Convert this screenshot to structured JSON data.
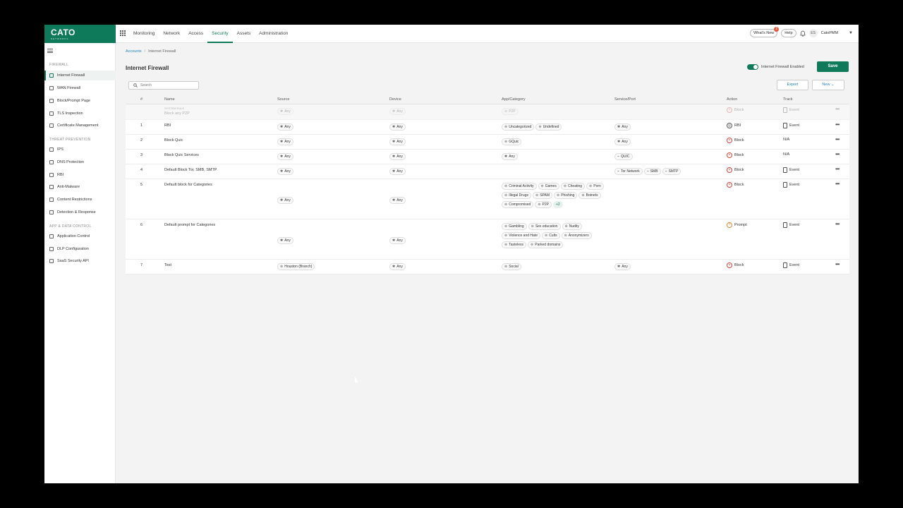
{
  "logo": {
    "brand": "CATO",
    "sub": "NETWORKS"
  },
  "nav": [
    "Monitoring",
    "Network",
    "Access",
    "Security",
    "Assets",
    "Administration"
  ],
  "active_nav": "Security",
  "top_right": {
    "whats_new": "What's New",
    "whats_new_count": "2",
    "help": "Help",
    "avatar": "ES",
    "account": "CatoPMM"
  },
  "sidebar": {
    "sections": [
      {
        "title": "FIREWALL",
        "items": [
          "Internet Firewall",
          "WAN Firewall",
          "Block/Prompt Page",
          "TLS Inspection",
          "Certificate Management"
        ]
      },
      {
        "title": "THREAT PREVENTION",
        "items": [
          "IPS",
          "DNS Protection",
          "RBI",
          "Anti-Malware",
          "Content Restrictions",
          "Detection & Response"
        ]
      },
      {
        "title": "APP & DATA CONTROL",
        "items": [
          "Application Control",
          "DLP Configuration",
          "SaaS Security API"
        ]
      }
    ],
    "active_item": "Internet Firewall"
  },
  "breadcrumb": {
    "link": "Accounts",
    "sep": "/",
    "current": "Internet Firewall"
  },
  "page_title": "Internet Firewall",
  "toggle_label": "Internet Firewall Enabled",
  "save_label": "Save",
  "search": {
    "placeholder": "Search"
  },
  "export_label": "Export",
  "new_label": "New",
  "columns": [
    "#",
    "Name",
    "Source",
    "Device",
    "App/Category",
    "Service/Port",
    "Action",
    "Track"
  ],
  "rows": [
    {
      "num": "",
      "tag": "SYSTEM RULE",
      "name": "Block any P2P",
      "source": [
        "Any"
      ],
      "device": [
        "Any"
      ],
      "app": [
        "P2P"
      ],
      "service": [],
      "action": "Block",
      "track": "Event"
    },
    {
      "num": "1",
      "name": "RBI",
      "source": [
        "Any"
      ],
      "device": [
        "Any"
      ],
      "app": [
        "Uncategorized",
        "Undefined"
      ],
      "service": [
        "Any"
      ],
      "action": "RBI",
      "track": "Event"
    },
    {
      "num": "2",
      "name": "Block Quic",
      "source": [
        "Any"
      ],
      "device": [
        "Any"
      ],
      "app": [
        "GQuic"
      ],
      "service": [
        "Any"
      ],
      "action": "Block",
      "track": "N/A"
    },
    {
      "num": "3",
      "name": "Block Quic Services",
      "source": [
        "Any"
      ],
      "device": [
        "Any"
      ],
      "app": [
        "Any"
      ],
      "service": [
        "QUIC"
      ],
      "action": "Block",
      "track": "N/A"
    },
    {
      "num": "4",
      "name": "Default Block Tor, SMB, SMTP",
      "source": [
        "Any"
      ],
      "device": [
        "Any"
      ],
      "app": [],
      "service": [
        "Tor Network",
        "SMB",
        "SMTP"
      ],
      "action": "Block",
      "track": "Event"
    },
    {
      "num": "5",
      "name": "Default block for Categories",
      "source": [
        "Any"
      ],
      "device": [
        "Any"
      ],
      "app": [
        "Criminal Activity",
        "Games",
        "Cheating",
        "Porn",
        "Illegal Drugs",
        "SPAM",
        "Phishing",
        "Botnets",
        "Compromised",
        "P2P"
      ],
      "app_more": "+2",
      "service": [],
      "action": "Block",
      "track": "Event"
    },
    {
      "num": "6",
      "name": "Default prompt for Categories",
      "source": [
        "Any"
      ],
      "device": [
        "Any"
      ],
      "app": [
        "Gambling",
        "Sex education",
        "Nudity",
        "Violence and Hate",
        "Cults",
        "Anonymizers",
        "Tasteless",
        "Parked domains"
      ],
      "service": [],
      "action": "Prompt",
      "track": "Event"
    },
    {
      "num": "7",
      "name": "Test",
      "source": [
        "Houston (Branch)"
      ],
      "device": [
        "Any"
      ],
      "app": [
        "Social"
      ],
      "service": [
        "Any"
      ],
      "action": "Block",
      "track": "Event"
    }
  ]
}
